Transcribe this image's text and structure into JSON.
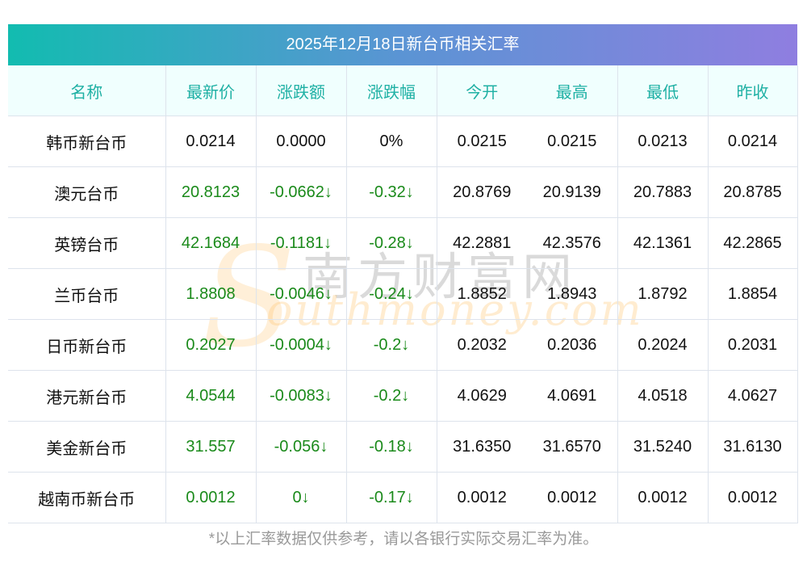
{
  "title": "2025年12月18日新台币相关汇率",
  "columns": [
    "名称",
    "最新价",
    "涨跌额",
    "涨跌幅",
    "今开",
    "最高",
    "最低",
    "昨收"
  ],
  "rows": [
    {
      "name": "韩币新台币",
      "latest": "0.0214",
      "change": "0.0000",
      "pct": "0%",
      "open": "0.0215",
      "high": "0.0215",
      "low": "0.0213",
      "prev": "0.0214",
      "down": false
    },
    {
      "name": "澳元台币",
      "latest": "20.8123",
      "change": "-0.0662↓",
      "pct": "-0.32↓",
      "open": "20.8769",
      "high": "20.9139",
      "low": "20.7883",
      "prev": "20.8785",
      "down": true
    },
    {
      "name": "英镑台币",
      "latest": "42.1684",
      "change": "-0.1181↓",
      "pct": "-0.28↓",
      "open": "42.2881",
      "high": "42.3576",
      "low": "42.1361",
      "prev": "42.2865",
      "down": true
    },
    {
      "name": "兰币台币",
      "latest": "1.8808",
      "change": "-0.0046↓",
      "pct": "-0.24↓",
      "open": "1.8852",
      "high": "1.8943",
      "low": "1.8792",
      "prev": "1.8854",
      "down": true
    },
    {
      "name": "日币新台币",
      "latest": "0.2027",
      "change": "-0.0004↓",
      "pct": "-0.2↓",
      "open": "0.2032",
      "high": "0.2036",
      "low": "0.2024",
      "prev": "0.2031",
      "down": true
    },
    {
      "name": "港元新台币",
      "latest": "4.0544",
      "change": "-0.0083↓",
      "pct": "-0.2↓",
      "open": "4.0629",
      "high": "4.0691",
      "low": "4.0518",
      "prev": "4.0627",
      "down": true
    },
    {
      "name": "美金新台币",
      "latest": "31.557",
      "change": "-0.056↓",
      "pct": "-0.18↓",
      "open": "31.6350",
      "high": "31.6570",
      "low": "31.5240",
      "prev": "31.6130",
      "down": true
    },
    {
      "name": "越南币新台币",
      "latest": "0.0012",
      "change": "0↓",
      "pct": "-0.17↓",
      "open": "0.0012",
      "high": "0.0012",
      "low": "0.0012",
      "prev": "0.0012",
      "down": true
    }
  ],
  "watermark": {
    "cn": "南方财富网",
    "en": "outhmoney.com",
    "s": "S"
  },
  "footer": "*以上汇率数据仅供参考，请以各银行实际交易汇率为准。",
  "colors": {
    "down": "#1a8a1a",
    "header_text": "#1fb0a4"
  }
}
